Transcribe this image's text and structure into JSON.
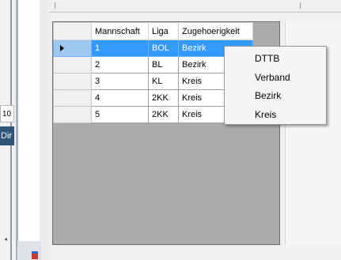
{
  "parent": {
    "left_cell_text": "10",
    "left_badge_text": "Dir",
    "scroll_arrow": "◂"
  },
  "grid": {
    "columns": [
      "Mannschaft",
      "Liga",
      "Zugehoerigkeit"
    ],
    "rows": [
      {
        "mannschaft": "1",
        "liga": "BOL",
        "zugehoerigkeit": "Bezirk"
      },
      {
        "mannschaft": "2",
        "liga": "BL",
        "zugehoerigkeit": "Bezirk"
      },
      {
        "mannschaft": "3",
        "liga": "KL",
        "zugehoerigkeit": "Kreis"
      },
      {
        "mannschaft": "4",
        "liga": "2KK",
        "zugehoerigkeit": "Kreis"
      },
      {
        "mannschaft": "5",
        "liga": "2KK",
        "zugehoerigkeit": "Kreis"
      }
    ],
    "selected_row_index": 0,
    "selection_color": "#3399ff",
    "current_row_icon": "current-row-arrow-icon"
  },
  "dropdown": {
    "items": [
      "DTTB",
      "Verband",
      "Bezirk",
      "Kreis"
    ]
  }
}
